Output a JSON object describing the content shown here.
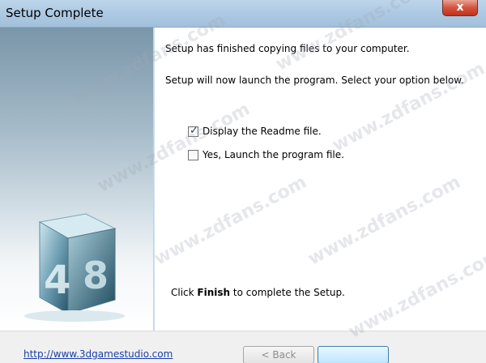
{
  "window": {
    "title": "Setup Complete",
    "close_glyph": "x"
  },
  "content": {
    "line1": "Setup has finished copying files to your computer.",
    "line2": "Setup will now launch the program. Select your option below.",
    "options": [
      {
        "label": "Display the Readme file.",
        "checked": true
      },
      {
        "label": "Yes, Launch the program file.",
        "checked": false
      }
    ],
    "finish_prefix": "Click ",
    "finish_bold": "Finish",
    "finish_suffix": " to complete the Setup."
  },
  "logo": {
    "text_top": "4",
    "text_side": "8"
  },
  "footer": {
    "link_text": "http://www.3dgamestudio.com",
    "back_label": "< Back"
  },
  "watermarks": [
    "www.zdfans.com",
    "www.zdfans.com",
    "www.zdfans.com",
    "www.zdfans.com",
    "www.zdfans.com",
    "www.zdfans.com",
    "www.zdfans.com"
  ],
  "colors": {
    "link": "#1a3fa8",
    "close_button": "#c0321c",
    "title_bar": "#aecae3"
  }
}
